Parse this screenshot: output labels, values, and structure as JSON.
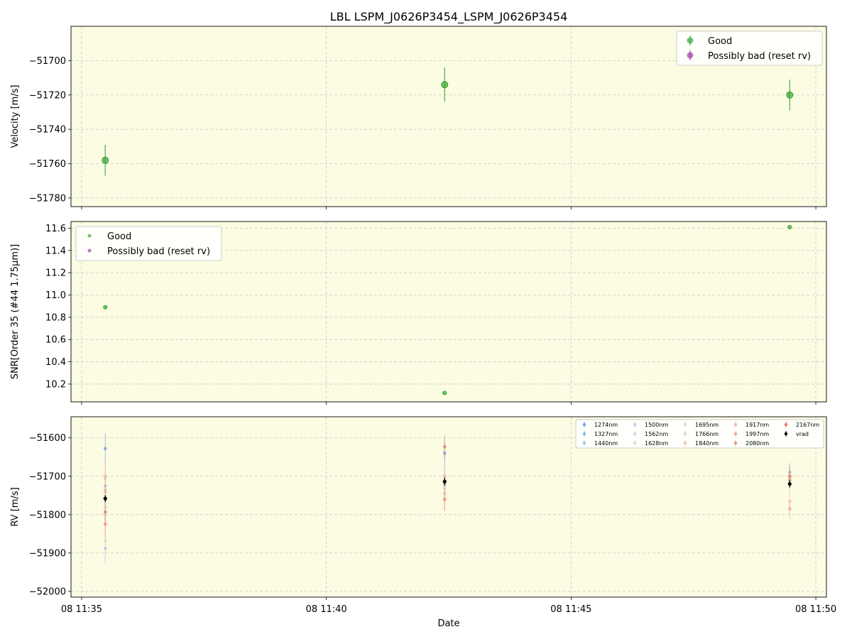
{
  "title": "LBL LSPM_J0626P3454_LSPM_J0626P3454",
  "xlabel": "Date",
  "x_ticks": [
    "08 11:35",
    "08 11:40",
    "08 11:45",
    "08 11:50"
  ],
  "colors": {
    "plot_bg": "#fcfce3",
    "good": "#2ca02c",
    "bad": "#9b30a0",
    "vrad": "#000000",
    "grid": "#c8c8c8"
  },
  "chart_data": [
    {
      "type": "scatter",
      "name": "velocity",
      "ylabel": "Velocity [m/s]",
      "xlim": [
        "11:34:47",
        "11:50:13"
      ],
      "ylim": [
        -51785,
        -51680
      ],
      "y_ticks": [
        -51700,
        -51720,
        -51740,
        -51760,
        -51780
      ],
      "y_tick_labels": [
        "−51700",
        "−51720",
        "−51740",
        "−51760",
        "−51780"
      ],
      "grid": true,
      "legend": {
        "placement": "top-right",
        "entries": [
          "Good",
          "Possibly bad (reset rv)"
        ]
      },
      "series": [
        {
          "name": "Good",
          "points": [
            {
              "x": "11:35:29",
              "y": -51758,
              "err": 9
            },
            {
              "x": "11:42:25",
              "y": -51714,
              "err": 10
            },
            {
              "x": "11:49:28",
              "y": -51720,
              "err": 9
            }
          ]
        },
        {
          "name": "Possibly bad (reset rv)",
          "points": []
        }
      ]
    },
    {
      "type": "scatter",
      "name": "snr",
      "ylabel": "SNR[Order 35 (#44 1.75μm)]",
      "xlim": [
        "11:34:47",
        "11:50:13"
      ],
      "ylim": [
        10.04,
        11.66
      ],
      "y_ticks": [
        10.2,
        10.4,
        10.6,
        10.8,
        11.0,
        11.2,
        11.4,
        11.6
      ],
      "y_tick_labels": [
        "10.2",
        "10.4",
        "10.6",
        "10.8",
        "11.0",
        "11.2",
        "11.4",
        "11.6"
      ],
      "grid": true,
      "legend": {
        "placement": "top-left",
        "entries": [
          "Good",
          "Possibly bad (reset rv)"
        ]
      },
      "series": [
        {
          "name": "Good",
          "points": [
            {
              "x": "11:35:29",
              "y": 10.89
            },
            {
              "x": "11:42:25",
              "y": 10.12
            },
            {
              "x": "11:49:28",
              "y": 11.61
            }
          ]
        },
        {
          "name": "Possibly bad (reset rv)",
          "points": []
        }
      ]
    },
    {
      "type": "scatter",
      "name": "rv",
      "ylabel": "RV [m/s]",
      "xlim": [
        "11:34:47",
        "11:50:13"
      ],
      "ylim": [
        -52015,
        -51545
      ],
      "y_ticks": [
        -51600,
        -51700,
        -51800,
        -51900,
        -52000
      ],
      "y_tick_labels": [
        "−51600",
        "−51700",
        "−51800",
        "−51900",
        "−52000"
      ],
      "grid": true,
      "legend": {
        "placement": "top-right",
        "columns": 5
      },
      "series": [
        {
          "name": "1274nm",
          "color": "#7b9ef0",
          "values": [
            -51628,
            -51640,
            -51700
          ],
          "err": [
            40,
            30,
            25
          ]
        },
        {
          "name": "1327nm",
          "color": "#8fb0f5",
          "values": [
            -51725,
            -51700,
            -51690
          ],
          "err": [
            35,
            30,
            25
          ]
        },
        {
          "name": "1440nm",
          "color": "#a8c4f8",
          "values": [
            -51888,
            -51720,
            -51700
          ],
          "err": [
            40,
            30,
            25
          ]
        },
        {
          "name": "1500nm",
          "color": "#bcd0f5",
          "values": [
            -51735,
            -51710,
            -51690
          ],
          "err": [
            35,
            28,
            22
          ]
        },
        {
          "name": "1562nm",
          "color": "#ccd6ee",
          "values": [
            -51760,
            -51715,
            -51700
          ],
          "err": [
            35,
            28,
            22
          ]
        },
        {
          "name": "1628nm",
          "color": "#d7dbe6",
          "values": [
            -51780,
            -51725,
            -51705
          ],
          "err": [
            35,
            28,
            22
          ]
        },
        {
          "name": "1695nm",
          "color": "#e2d9d2",
          "values": [
            -51800,
            -51730,
            -51710
          ],
          "err": [
            35,
            28,
            22
          ]
        },
        {
          "name": "1766nm",
          "color": "#ecd3c3",
          "values": [
            -51868,
            -51710,
            -51720
          ],
          "err": [
            35,
            28,
            22
          ]
        },
        {
          "name": "1840nm",
          "color": "#f2c6b1",
          "values": [
            -51705,
            -51745,
            -51765
          ],
          "err": [
            35,
            28,
            22
          ]
        },
        {
          "name": "1917nm",
          "color": "#f5b89e",
          "values": [
            -51700,
            -51700,
            -51700
          ],
          "err": [
            35,
            28,
            22
          ]
        },
        {
          "name": "1997nm",
          "color": "#f4a78a",
          "values": [
            -51740,
            -51760,
            -51785
          ],
          "err": [
            35,
            30,
            25
          ]
        },
        {
          "name": "2080nm",
          "color": "#ef9578",
          "values": [
            -51825,
            -51760,
            -51710
          ],
          "err": [
            35,
            30,
            25
          ]
        },
        {
          "name": "2167nm",
          "color": "#e57e66",
          "values": [
            -51793,
            -51623,
            -51700
          ],
          "err": [
            35,
            30,
            25
          ]
        },
        {
          "name": "vrad",
          "color": "#000000",
          "values": [
            -51758,
            -51714,
            -51720
          ],
          "err": [
            9,
            10,
            9
          ]
        }
      ],
      "x": [
        "11:35:29",
        "11:42:25",
        "11:49:28"
      ]
    }
  ]
}
